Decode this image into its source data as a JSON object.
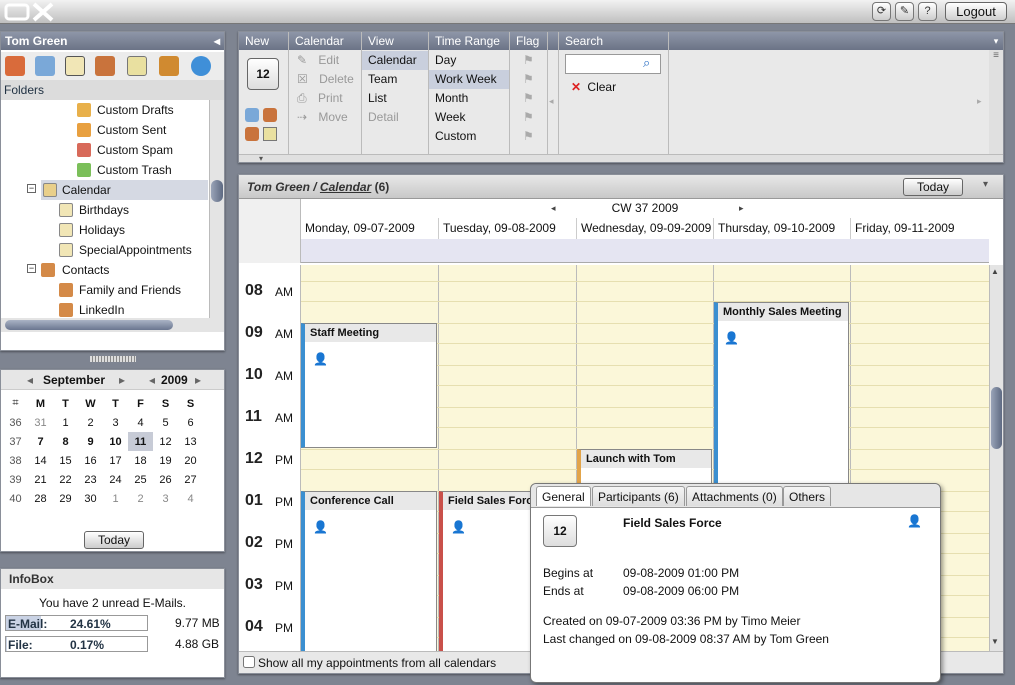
{
  "app": {
    "logo": "OX",
    "logout_label": "Logout"
  },
  "sidebar": {
    "user": "Tom Green",
    "folders_label": "Folders",
    "tree": [
      {
        "label": "Custom Drafts"
      },
      {
        "label": "Custom Sent"
      },
      {
        "label": "Custom Spam"
      },
      {
        "label": "Custom Trash"
      },
      {
        "label": "Calendar"
      },
      {
        "label": "Birthdays"
      },
      {
        "label": "Holidays"
      },
      {
        "label": "SpecialAppointments"
      },
      {
        "label": "Contacts"
      },
      {
        "label": "Family and Friends"
      },
      {
        "label": "LinkedIn"
      }
    ],
    "modules": [
      "home-icon",
      "mail-icon",
      "calendar-icon",
      "contacts-icon",
      "tasks-icon",
      "portfolio-icon",
      "settings-icon"
    ]
  },
  "mini_calendar": {
    "month": "September",
    "year": "2009",
    "weekday_headers": [
      "M",
      "T",
      "W",
      "T",
      "F",
      "S",
      "S"
    ],
    "weeks": [
      {
        "cw": "36",
        "days": [
          "31",
          "1",
          "2",
          "3",
          "4",
          "5",
          "6"
        ]
      },
      {
        "cw": "37",
        "days": [
          "7",
          "8",
          "9",
          "10",
          "11",
          "12",
          "13"
        ]
      },
      {
        "cw": "38",
        "days": [
          "14",
          "15",
          "16",
          "17",
          "18",
          "19",
          "20"
        ]
      },
      {
        "cw": "39",
        "days": [
          "21",
          "22",
          "23",
          "24",
          "25",
          "26",
          "27"
        ]
      },
      {
        "cw": "40",
        "days": [
          "28",
          "29",
          "30",
          "1",
          "2",
          "3",
          "4"
        ]
      }
    ],
    "today_label": "Today"
  },
  "infobox": {
    "title": "InfoBox",
    "message": "You have 2 unread E-Mails.",
    "email_label": "E-Mail:",
    "email_pct": "24.61%",
    "email_size": "9.77 MB",
    "file_label": "File:",
    "file_pct": "0.17%",
    "file_size": "4.88 GB"
  },
  "toolbar": {
    "new_label": "New",
    "calendar": {
      "label": "Calendar",
      "items": [
        "Edit",
        "Delete",
        "Print",
        "Move"
      ]
    },
    "view": {
      "label": "View",
      "items": [
        "Calendar",
        "Team",
        "List",
        "Detail"
      ]
    },
    "time_range": {
      "label": "Time Range",
      "items": [
        "Day",
        "Work Week",
        "Month",
        "Week",
        "Custom"
      ]
    },
    "flag_label": "Flag",
    "search": {
      "label": "Search",
      "placeholder": "",
      "clear_label": "Clear"
    }
  },
  "calendar": {
    "breadcrumb_user": "Tom Green",
    "breadcrumb_sep": " / ",
    "breadcrumb_folder": "Calendar",
    "count": "(6)",
    "today_label": "Today",
    "cw": "CW 37 2009",
    "days": [
      "Monday, 09-07-2009",
      "Tuesday, 09-08-2009",
      "Wednesday, 09-09-2009",
      "Thursday, 09-10-2009",
      "Friday, 09-11-2009"
    ],
    "hours": [
      {
        "h": "08",
        "ap": "AM"
      },
      {
        "h": "09",
        "ap": "AM"
      },
      {
        "h": "10",
        "ap": "AM"
      },
      {
        "h": "11",
        "ap": "AM"
      },
      {
        "h": "12",
        "ap": "PM"
      },
      {
        "h": "01",
        "ap": "PM"
      },
      {
        "h": "02",
        "ap": "PM"
      },
      {
        "h": "03",
        "ap": "PM"
      },
      {
        "h": "04",
        "ap": "PM"
      }
    ],
    "appointments": [
      {
        "title": "Staff Meeting"
      },
      {
        "title": "Monthly Sales Meeting"
      },
      {
        "title": "Launch with Tom"
      },
      {
        "title": "Conference Call"
      },
      {
        "title": "Field Sales Force"
      }
    ],
    "show_all_label": "Show all my appointments from all calendars"
  },
  "popup": {
    "tabs": [
      "General",
      "Participants (6)",
      "Attachments (0)",
      "Others"
    ],
    "title": "Field Sales Force",
    "begins_label": "Begins at",
    "begins_value": "09-08-2009 01:00 PM",
    "ends_label": "Ends at",
    "ends_value": "09-08-2009 06:00 PM",
    "created": "Created on 09-07-2009 03:36 PM by Timo Meier",
    "changed": "Last changed on 09-08-2009 08:37 AM by Tom Green"
  },
  "colors": {
    "header": "#6b7386",
    "calendar_bg": "#fbf7d9",
    "appt_blue": "#3b8fd0",
    "appt_red": "#c9504a",
    "appt_orange": "#e2a44a"
  }
}
